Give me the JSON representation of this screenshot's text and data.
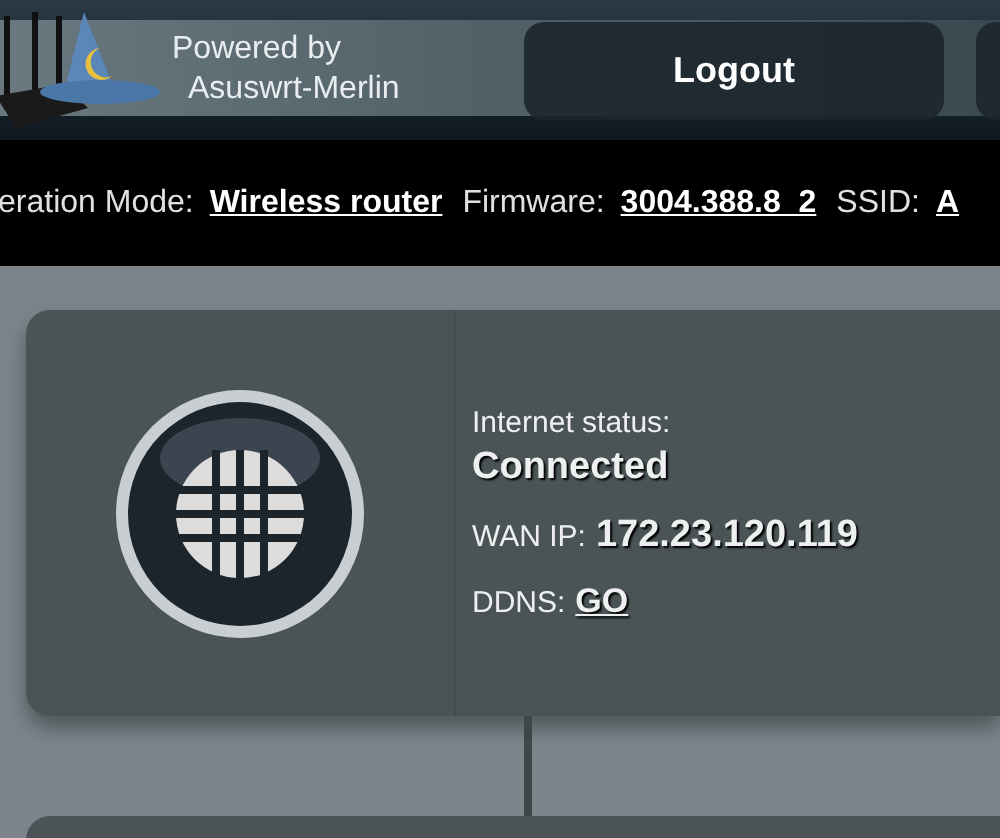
{
  "header": {
    "brand_line_1": "Powered by",
    "brand_line_2": "Asuswrt-Merlin",
    "buttons": [
      "Logout"
    ]
  },
  "info_bar": [
    {
      "label": "eration Mode:",
      "value": "Wireless router"
    },
    {
      "label": "Firmware:",
      "value": "3004.388.8_2"
    },
    {
      "label": "SSID:",
      "value": "A"
    }
  ],
  "internet_card": {
    "status_label": "Internet status:",
    "status": "Connected",
    "wan_ip_label": "WAN IP:",
    "wan_ip": "172.23.120.119",
    "ddns_label": "DDNS:",
    "ddns_link": "GO"
  }
}
